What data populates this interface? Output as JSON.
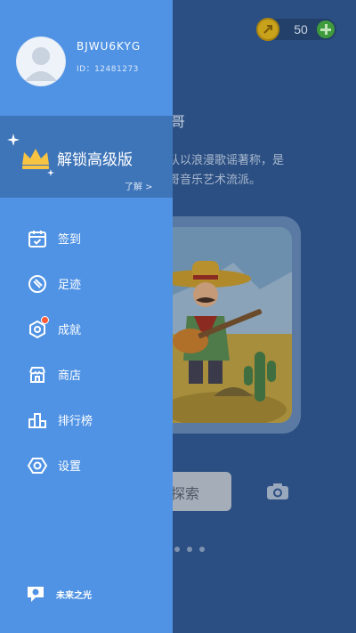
{
  "header": {
    "coins": "50"
  },
  "background": {
    "title_fragment": "西哥",
    "desc_line1": "乐队以浪漫歌谣著称，是",
    "desc_line2": "西哥音乐艺术流派。",
    "explore_label": "始探索"
  },
  "drawer": {
    "username": "BJWU6KYG",
    "user_id": "ID：12481273",
    "premium": {
      "title": "解锁高级版",
      "link": "了解 >"
    },
    "menu": [
      {
        "label": "签到",
        "icon": "calendar-check-icon"
      },
      {
        "label": "足迹",
        "icon": "footprint-icon"
      },
      {
        "label": "成就",
        "icon": "achievement-icon",
        "badge": true
      },
      {
        "label": "商店",
        "icon": "shop-icon"
      },
      {
        "label": "排行榜",
        "icon": "leaderboard-icon"
      },
      {
        "label": "设置",
        "icon": "settings-icon"
      }
    ],
    "brand": "未来之光"
  },
  "colors": {
    "drawer": "#5093e4",
    "premium_band": "#3e74b8",
    "overlay_bg": "#2b4f82",
    "badge": "#ff5a36",
    "crown": "#f6c343"
  }
}
